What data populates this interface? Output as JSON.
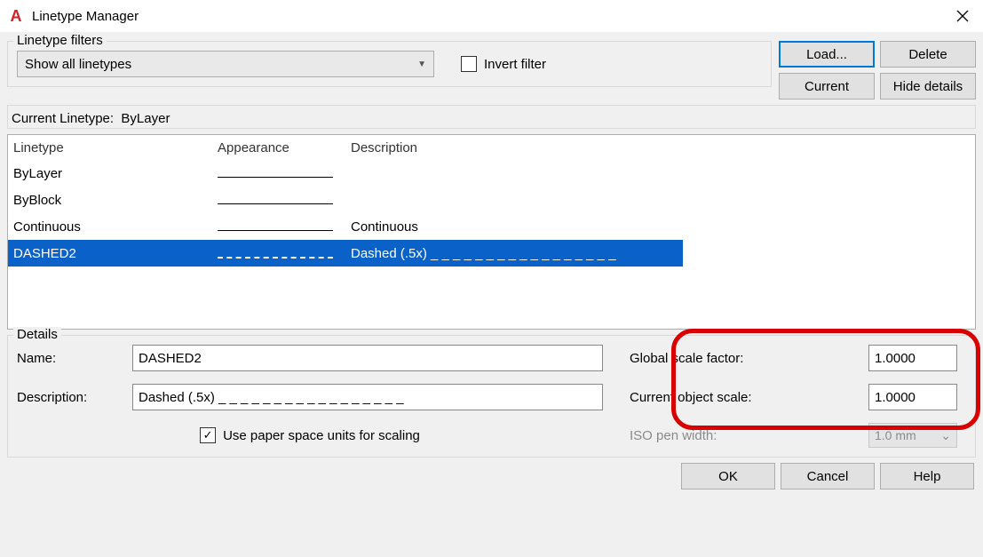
{
  "window": {
    "title": "Linetype Manager"
  },
  "filters": {
    "legend": "Linetype filters",
    "dropdown_value": "Show all linetypes",
    "invert_label": "Invert filter",
    "invert_checked": false
  },
  "buttons": {
    "load": "Load...",
    "delete": "Delete",
    "current": "Current",
    "hide_details": "Hide details",
    "ok": "OK",
    "cancel": "Cancel",
    "help": "Help"
  },
  "current_linetype": {
    "label": "Current Linetype:",
    "value": "ByLayer"
  },
  "columns": {
    "linetype": "Linetype",
    "appearance": "Appearance",
    "description": "Description"
  },
  "rows": [
    {
      "name": "ByLayer",
      "type": "solid",
      "desc": ""
    },
    {
      "name": "ByBlock",
      "type": "solid",
      "desc": ""
    },
    {
      "name": "Continuous",
      "type": "solid",
      "desc": "Continuous"
    },
    {
      "name": "DASHED2",
      "type": "dashed",
      "desc": "Dashed (.5x) _ _ _ _ _ _ _ _ _ _ _ _ _ _ _ _ _",
      "selected": true
    }
  ],
  "details": {
    "legend": "Details",
    "name_label": "Name:",
    "name_value": "DASHED2",
    "desc_label": "Description:",
    "desc_value": "Dashed (.5x) _ _ _ _ _ _ _ _ _ _ _ _ _ _ _ _ _",
    "paperspace_label": "Use paper space units for scaling",
    "paperspace_checked": true,
    "global_label": "Global scale factor:",
    "global_value": "1.0000",
    "object_label": "Current object scale:",
    "object_value": "1.0000",
    "iso_label": "ISO pen width:",
    "iso_value": "1.0 mm"
  }
}
